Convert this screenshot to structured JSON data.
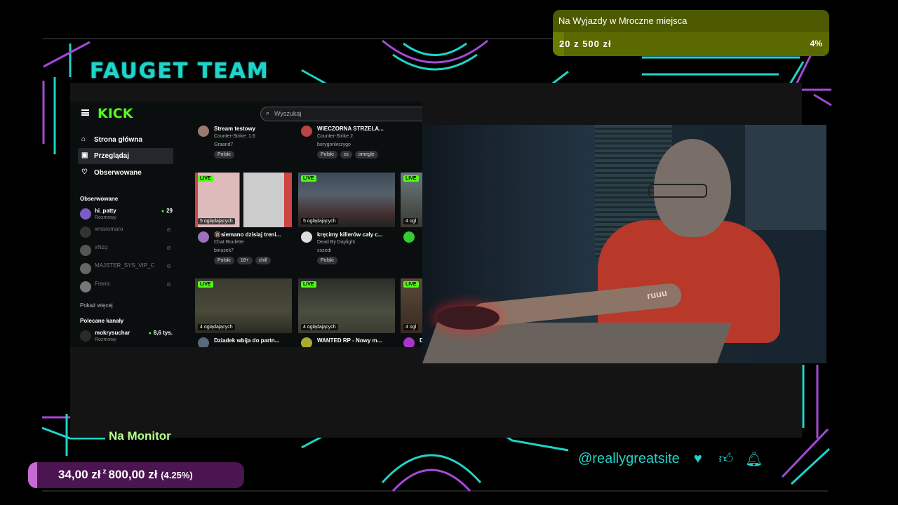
{
  "overlay": {
    "team_title": "FAUGET TEAM",
    "social_handle": "@reallygreatsite",
    "accent": "#1fd4c8",
    "accent2": "#a34ad6"
  },
  "goal_top": {
    "title": "Na Wyjazdy w Mroczne miejsca",
    "amount": "20 z 500 zł",
    "percent_label": "4%",
    "progress": 0.04
  },
  "goal_bottom": {
    "label": "Na Monitor",
    "current": "34,00 zł",
    "sep": "z",
    "target": "800,00 zł",
    "percent": "(4.25%)",
    "progress": 0.0425
  },
  "kick": {
    "logo": "KICK",
    "search_placeholder": "Wyszukaj",
    "nav": [
      {
        "label": "Strona główna",
        "icon": "home-icon"
      },
      {
        "label": "Przeglądaj",
        "icon": "browse-icon"
      },
      {
        "label": "Obserwowane",
        "icon": "heart-icon"
      }
    ],
    "followed_header": "Obserwowane",
    "followed": [
      {
        "name": "hi_patty",
        "sub": "Rozmowy",
        "count": "29",
        "online": true
      },
      {
        "name": "xmaromaro",
        "online": false
      },
      {
        "name": "xNzq",
        "online": false
      },
      {
        "name": "MAJSTER_SYS_VIP_C",
        "online": false
      },
      {
        "name": "Franic",
        "online": false
      }
    ],
    "show_more": "Pokaż więcej",
    "recommended_header": "Polecane kanały",
    "recommended": [
      {
        "name": "mokrysuchar",
        "sub": "Rozmowy",
        "count": "8,6 tys."
      }
    ],
    "live_label": "LIVE",
    "cards_row0": [
      {
        "title": "Stream testowy",
        "category": "Counter-Strike: 1.6",
        "user": "Graand7",
        "tags": [
          "Polski"
        ]
      },
      {
        "title": "WIECZORNA STRZELA...",
        "category": "Counter-Strike 2",
        "user": "borygonlerzygo",
        "tags": [
          "Polski",
          "cs",
          "omegle"
        ]
      }
    ],
    "cards_row1": [
      {
        "viewers": "5 oglądających",
        "title": "🔞siemano dzisiaj treni...",
        "category": "Chat Roulette",
        "user": "binusek7",
        "tags": [
          "Polski",
          "18+",
          "chill"
        ]
      },
      {
        "viewers": "5 oglądających",
        "title": "kręcimy killerów cały c...",
        "category": "Dead By Daylight",
        "user": "xszedi",
        "tags": [
          "Polski"
        ]
      },
      {
        "viewers": "4 ogl"
      }
    ],
    "cards_row2": [
      {
        "viewers": "4 oglądających",
        "title": "Dziadek wbija do partn..."
      },
      {
        "viewers": "4 oglądających",
        "title": "WANTED RP - Nowy m..."
      },
      {
        "viewers": "4 ogl",
        "title": "D"
      }
    ]
  },
  "webcam": {
    "shirt_logo": "ruuu"
  }
}
